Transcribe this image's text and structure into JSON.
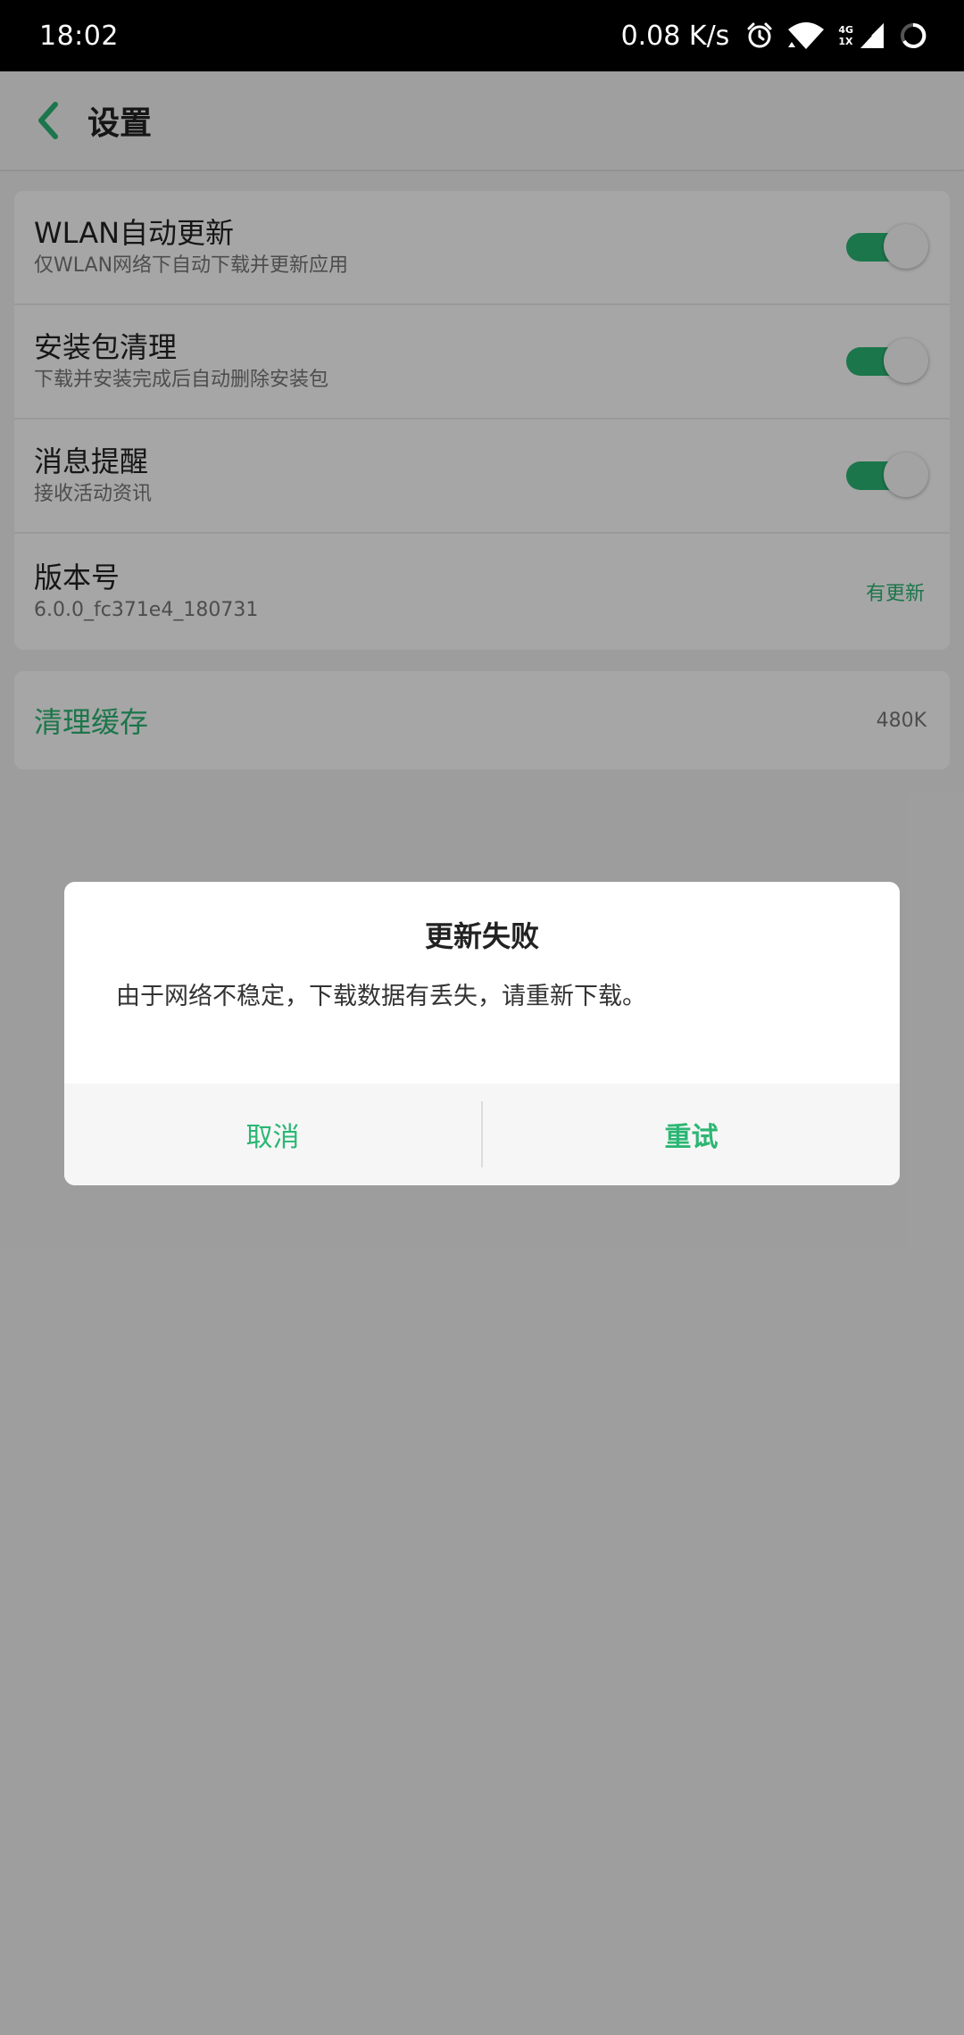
{
  "status_bar": {
    "time": "18:02",
    "speed": "0.08 K/s",
    "net_top": "4G",
    "net_bottom": "1X"
  },
  "header": {
    "title": "设置"
  },
  "settings": {
    "items": [
      {
        "title": "WLAN自动更新",
        "subtitle": "仅WLAN网络下自动下载并更新应用",
        "enabled": true
      },
      {
        "title": "安装包清理",
        "subtitle": "下载并安装完成后自动删除安装包",
        "enabled": true
      },
      {
        "title": "消息提醒",
        "subtitle": "接收活动资讯",
        "enabled": true
      }
    ],
    "version": {
      "title": "版本号",
      "value": "6.0.0_fc371e4_180731",
      "update_label": "有更新"
    }
  },
  "cache": {
    "title": "清理缓存",
    "size": "480K"
  },
  "dialog": {
    "title": "更新失败",
    "message": "由于网络不稳定，下载数据有丢失，请重新下载。",
    "cancel_label": "取消",
    "retry_label": "重试"
  },
  "colors": {
    "accent": "#2bb673",
    "status_bar": "#000000",
    "overlay": "rgba(0,0,0,0.35)"
  }
}
